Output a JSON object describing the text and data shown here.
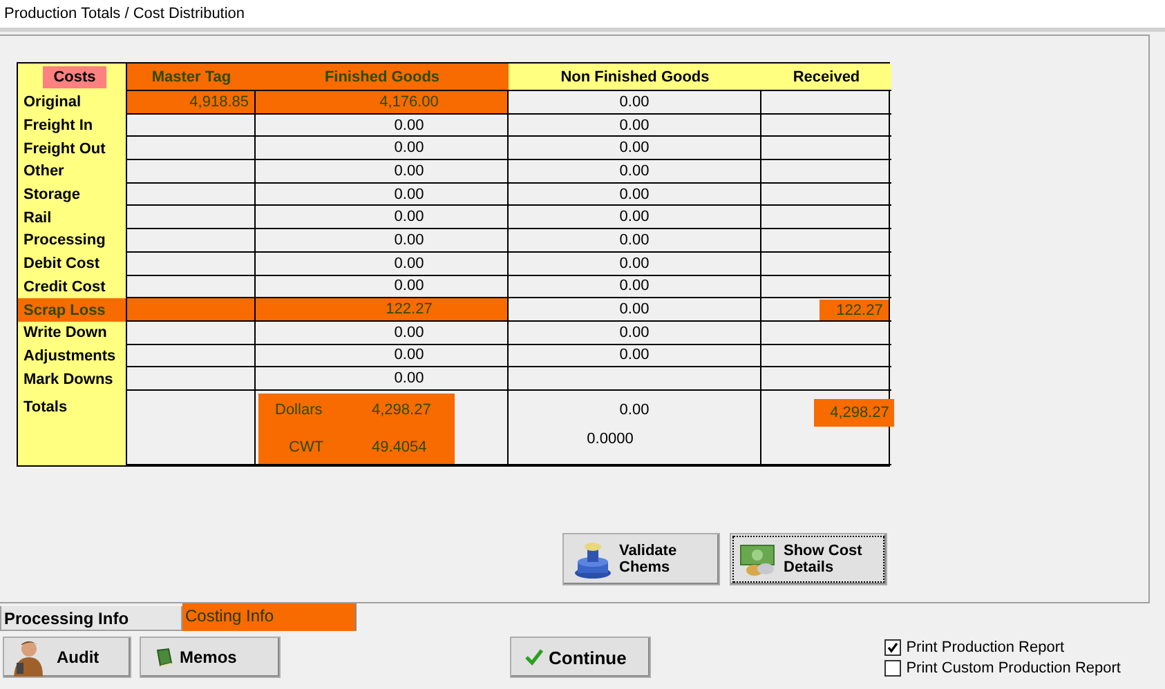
{
  "window": {
    "title": "Production Totals / Cost Distribution"
  },
  "table": {
    "columns": [
      {
        "label": "Costs",
        "highlighted": true
      },
      {
        "label": "Master Tag",
        "highlighted": true
      },
      {
        "label": "Finished Goods",
        "highlighted": true
      },
      {
        "label": "Non Finished Goods",
        "highlighted": false
      },
      {
        "label": "Received",
        "highlighted": false
      }
    ],
    "rows": [
      {
        "cells": [
          {
            "value": "Original",
            "highlighted": false
          },
          {
            "value": "4,918.85",
            "highlighted": true
          },
          {
            "value": "4,176.00",
            "highlighted": true
          },
          {
            "value": "0.00",
            "highlighted": false
          },
          {
            "highlighted": false
          }
        ]
      },
      {
        "cells": [
          {
            "value": "Freight In",
            "highlighted": false
          },
          {
            "highlighted": false
          },
          {
            "value": "0.00",
            "highlighted": false
          },
          {
            "value": "0.00",
            "highlighted": false
          },
          {
            "highlighted": false
          }
        ]
      },
      {
        "cells": [
          {
            "value": "Freight Out",
            "highlighted": false
          },
          {
            "highlighted": false
          },
          {
            "value": "0.00",
            "highlighted": false
          },
          {
            "value": "0.00",
            "highlighted": false
          },
          {
            "highlighted": false
          }
        ]
      },
      {
        "cells": [
          {
            "value": "Other",
            "highlighted": false
          },
          {
            "highlighted": false
          },
          {
            "value": "0.00",
            "highlighted": false
          },
          {
            "value": "0.00",
            "highlighted": false
          },
          {
            "highlighted": false
          }
        ]
      },
      {
        "cells": [
          {
            "value": "Storage",
            "highlighted": false
          },
          {
            "highlighted": false
          },
          {
            "value": "0.00",
            "highlighted": false
          },
          {
            "value": "0.00",
            "highlighted": false
          },
          {
            "highlighted": false
          }
        ]
      },
      {
        "cells": [
          {
            "value": "Rail",
            "highlighted": false
          },
          {
            "highlighted": false
          },
          {
            "value": "0.00",
            "highlighted": false
          },
          {
            "value": "0.00",
            "highlighted": false
          },
          {
            "highlighted": false
          }
        ]
      },
      {
        "cells": [
          {
            "value": "Processing",
            "highlighted": false
          },
          {
            "highlighted": false
          },
          {
            "value": "0.00",
            "highlighted": false
          },
          {
            "value": "0.00",
            "highlighted": false
          },
          {
            "highlighted": false
          }
        ]
      },
      {
        "cells": [
          {
            "value": "Debit Cost",
            "highlighted": false
          },
          {
            "highlighted": false
          },
          {
            "value": "0.00",
            "highlighted": false
          },
          {
            "value": "0.00",
            "highlighted": false
          },
          {
            "highlighted": false
          }
        ]
      },
      {
        "cells": [
          {
            "value": "Credit Cost",
            "highlighted": false
          },
          {
            "highlighted": false
          },
          {
            "value": "0.00",
            "highlighted": false
          },
          {
            "value": "0.00",
            "highlighted": false
          },
          {
            "highlighted": false
          }
        ]
      },
      {
        "cells": [
          {
            "value": "Scrap Loss",
            "highlighted": true
          },
          {
            "highlighted": true
          },
          {
            "value": "122.27",
            "highlighted": true
          },
          {
            "value": "0.00",
            "highlighted": false
          },
          {
            "value": "122.27",
            "highlighted": true
          }
        ]
      },
      {
        "cells": [
          {
            "value": "Write Down",
            "highlighted": false
          },
          {
            "highlighted": false
          },
          {
            "value": "0.00",
            "highlighted": false
          },
          {
            "value": "0.00",
            "highlighted": false
          },
          {
            "highlighted": false
          }
        ]
      },
      {
        "cells": [
          {
            "value": "Adjustments",
            "highlighted": false
          },
          {
            "highlighted": false
          },
          {
            "value": "0.00",
            "highlighted": false
          },
          {
            "value": "0.00",
            "highlighted": false
          },
          {
            "highlighted": false
          }
        ]
      },
      {
        "cells": [
          {
            "value": "Mark Downs",
            "highlighted": false
          },
          {
            "highlighted": false
          },
          {
            "value": "0.00",
            "highlighted": false
          },
          {
            "highlighted": false
          },
          {
            "highlighted": false
          }
        ]
      }
    ],
    "totals": {
      "label": "Totals",
      "highlighted": true,
      "dollars_label": "Dollars",
      "dollars": "4,298.27",
      "cwt_label": "CWT",
      "cwt": "49.4054",
      "non_finished_dollars": "0.00",
      "non_finished_cwt": "0.0000",
      "received": "4,298.27",
      "received_highlighted": true
    }
  },
  "buttons": [
    {
      "label": "Validate Chems",
      "kind": "stamp",
      "focused": false
    },
    {
      "label": "Show Cost Details",
      "kind": "money",
      "focused": true
    }
  ],
  "tabs": [
    {
      "label": "Processing Info",
      "selected": false
    },
    {
      "label": "Costing Info",
      "selected": true
    }
  ],
  "actions": [
    {
      "label": "Audit",
      "kind": "person"
    },
    {
      "label": "Memos",
      "kind": "book"
    },
    {
      "label": "Continue",
      "kind": "check"
    }
  ],
  "options": [
    {
      "label": "Print Production Report",
      "checked": true
    },
    {
      "label": "Print Custom Production Report",
      "checked": false
    }
  ]
}
